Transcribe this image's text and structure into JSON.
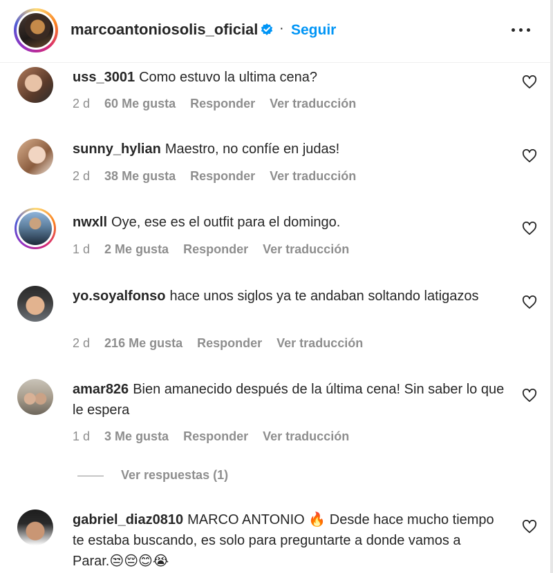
{
  "header": {
    "username": "marcoantoniosolis_oficial",
    "separator": "·",
    "follow_label": "Seguir"
  },
  "comments": [
    {
      "user": "uss_3001",
      "text": "Como estuvo la ultima cena?",
      "age": "2 d",
      "likes": "60 Me gusta",
      "reply": "Responder",
      "translate": "Ver traducción"
    },
    {
      "user": "sunny_hylian",
      "text": "Maestro, no confíe en judas!",
      "age": "2 d",
      "likes": "38 Me gusta",
      "reply": "Responder",
      "translate": "Ver traducción"
    },
    {
      "user": "nwxll",
      "text": "Oye, ese es el outfit para el domingo.",
      "age": "1 d",
      "likes": "2 Me gusta",
      "reply": "Responder",
      "translate": "Ver traducción"
    },
    {
      "user": "yo.soyalfonso",
      "text": "hace unos siglos ya te andaban soltando latigazos",
      "age": "2 d",
      "likes": "216 Me gusta",
      "reply": "Responder",
      "translate": "Ver traducción"
    },
    {
      "user": "amar826",
      "text": "Bien amanecido después de la última cena! Sin saber lo que le espera",
      "age": "1 d",
      "likes": "3 Me gusta",
      "reply": "Responder",
      "translate": "Ver traducción"
    },
    {
      "user": "gabriel_diaz0810",
      "text": "MARCO ANTONIO 🔥 Desde hace mucho tiempo te estaba buscando, es solo para preguntarte a donde vamos a Parar.😒😔😊😭"
    }
  ],
  "view_replies": "Ver respuestas (1)",
  "colors": {
    "accent": "#0095f6",
    "muted": "#8e8e8e",
    "text": "#262626"
  }
}
